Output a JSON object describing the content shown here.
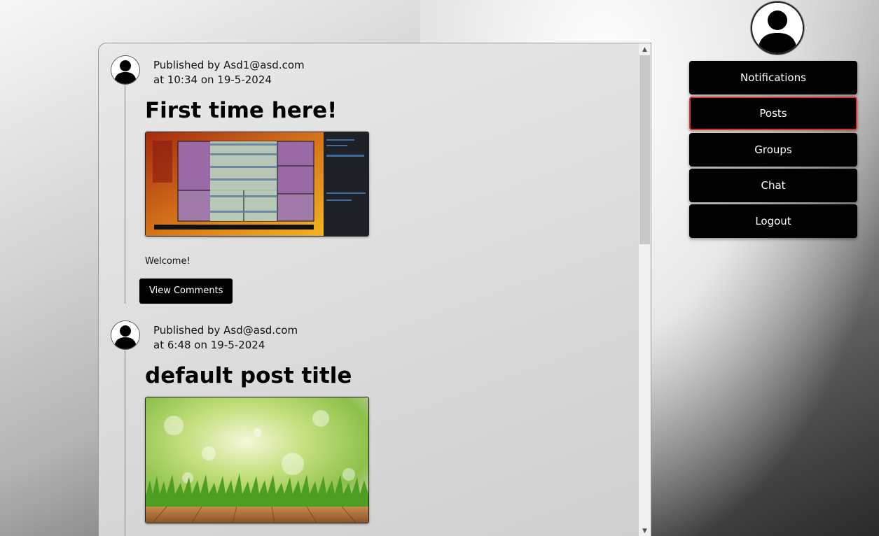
{
  "nav": {
    "items": [
      {
        "label": "Notifications",
        "active": false
      },
      {
        "label": "Posts",
        "active": true
      },
      {
        "label": "Groups",
        "active": false
      },
      {
        "label": "Chat",
        "active": false
      },
      {
        "label": "Logout",
        "active": false
      }
    ],
    "active_border_color": "#d9302c"
  },
  "posts": [
    {
      "author_line": "Published by Asd1@asd.com",
      "time_line": "at 10:34 on 19-5-2024",
      "title": "First time here!",
      "image": "website-screenshot-thumbnail",
      "body": "Welcome!",
      "comments_button": "View Comments"
    },
    {
      "author_line": "Published by Asd@asd.com",
      "time_line": "at 6:48 on 19-5-2024",
      "title": "default post title",
      "image": "green-bokeh-grass-wood-floor"
    }
  ],
  "icons": {
    "avatar": "user-silhouette-icon",
    "scroll_up": "scroll-up-arrow-icon",
    "scroll_down": "scroll-down-arrow-icon"
  }
}
